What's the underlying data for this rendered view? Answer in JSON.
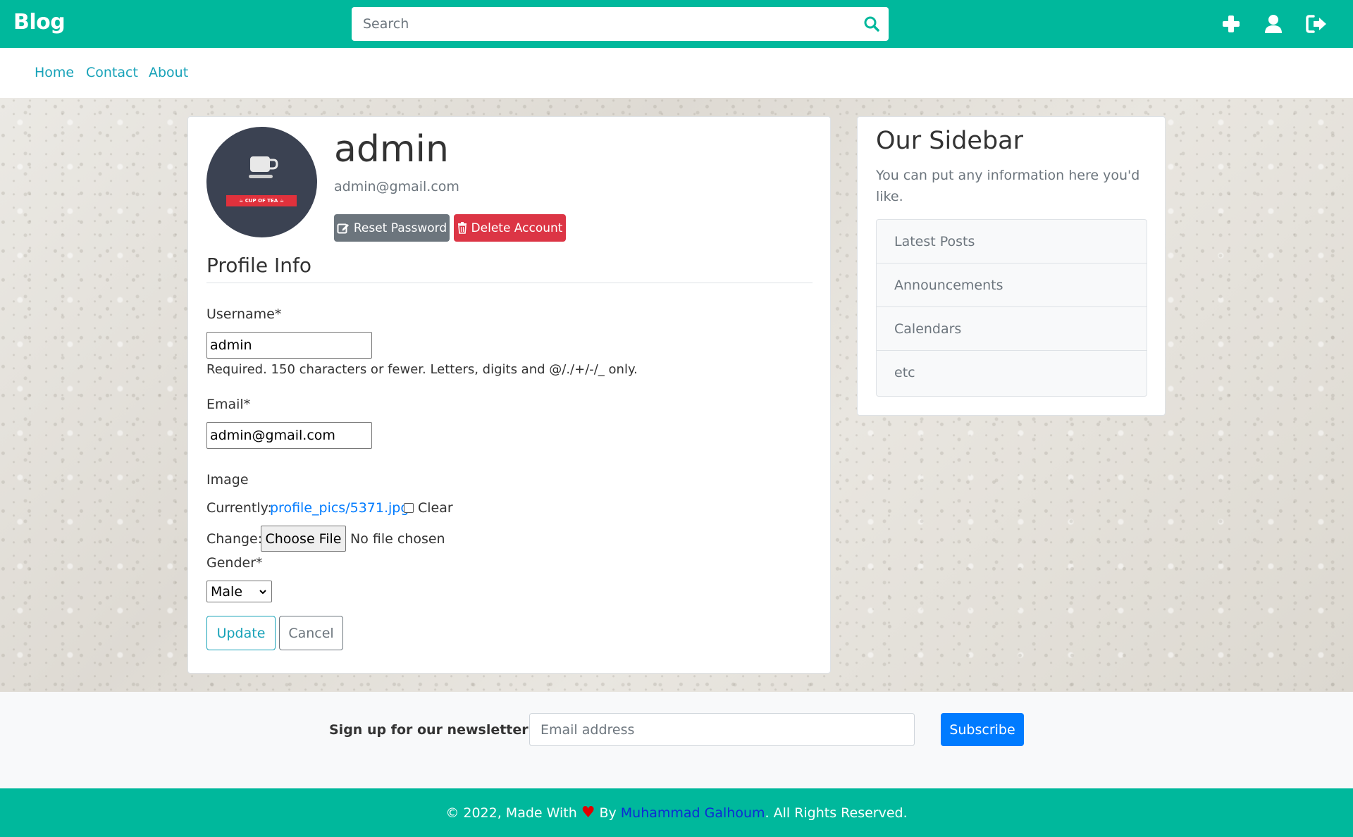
{
  "header": {
    "brand": "Blog",
    "search_placeholder": "Search",
    "icons": [
      "search-icon",
      "plus-icon",
      "user-icon",
      "sign-out-icon"
    ],
    "colors": {
      "bar": "#00b89c",
      "icon": "#ffffff"
    }
  },
  "subnav": {
    "links": [
      {
        "label": "Home"
      },
      {
        "label": "Contact"
      },
      {
        "label": "About"
      }
    ],
    "color": "#17a2b8"
  },
  "profile": {
    "avatar_banner": "☕ CUP OF TEA ☕",
    "username": "admin",
    "email": "admin@gmail.com",
    "reset_label": "Reset Password",
    "delete_label": "Delete Account",
    "section_title": "Profile Info"
  },
  "form": {
    "username_label": "Username*",
    "username_value": "admin",
    "username_help": "Required. 150 characters or fewer. Letters, digits and @/./+/-/_ only.",
    "email_label": "Email*",
    "email_value": "admin@gmail.com",
    "image_label": "Image",
    "currently_label": "Currently:",
    "current_file": "profile_pics/5371.jpg",
    "clear_label": "Clear",
    "change_label": "Change:",
    "choose_file_label": "Choose File",
    "no_file_text": "No file chosen",
    "gender_label": "Gender*",
    "gender_value": "Male",
    "update_label": "Update",
    "cancel_label": "Cancel"
  },
  "sidebar": {
    "title": "Our Sidebar",
    "text": "You can put any information here you'd like.",
    "items": [
      {
        "label": "Latest Posts"
      },
      {
        "label": "Announcements"
      },
      {
        "label": "Calendars"
      },
      {
        "label": "etc"
      }
    ]
  },
  "newsletter": {
    "label": "Sign up for our newsletter",
    "placeholder": "Email address",
    "button": "Subscribe"
  },
  "footer": {
    "prefix": "© 2022, Made With",
    "heart": "♥",
    "by": "By",
    "author": "Muhammad Galhoum",
    "suffix": ". All Rights Reserved."
  }
}
